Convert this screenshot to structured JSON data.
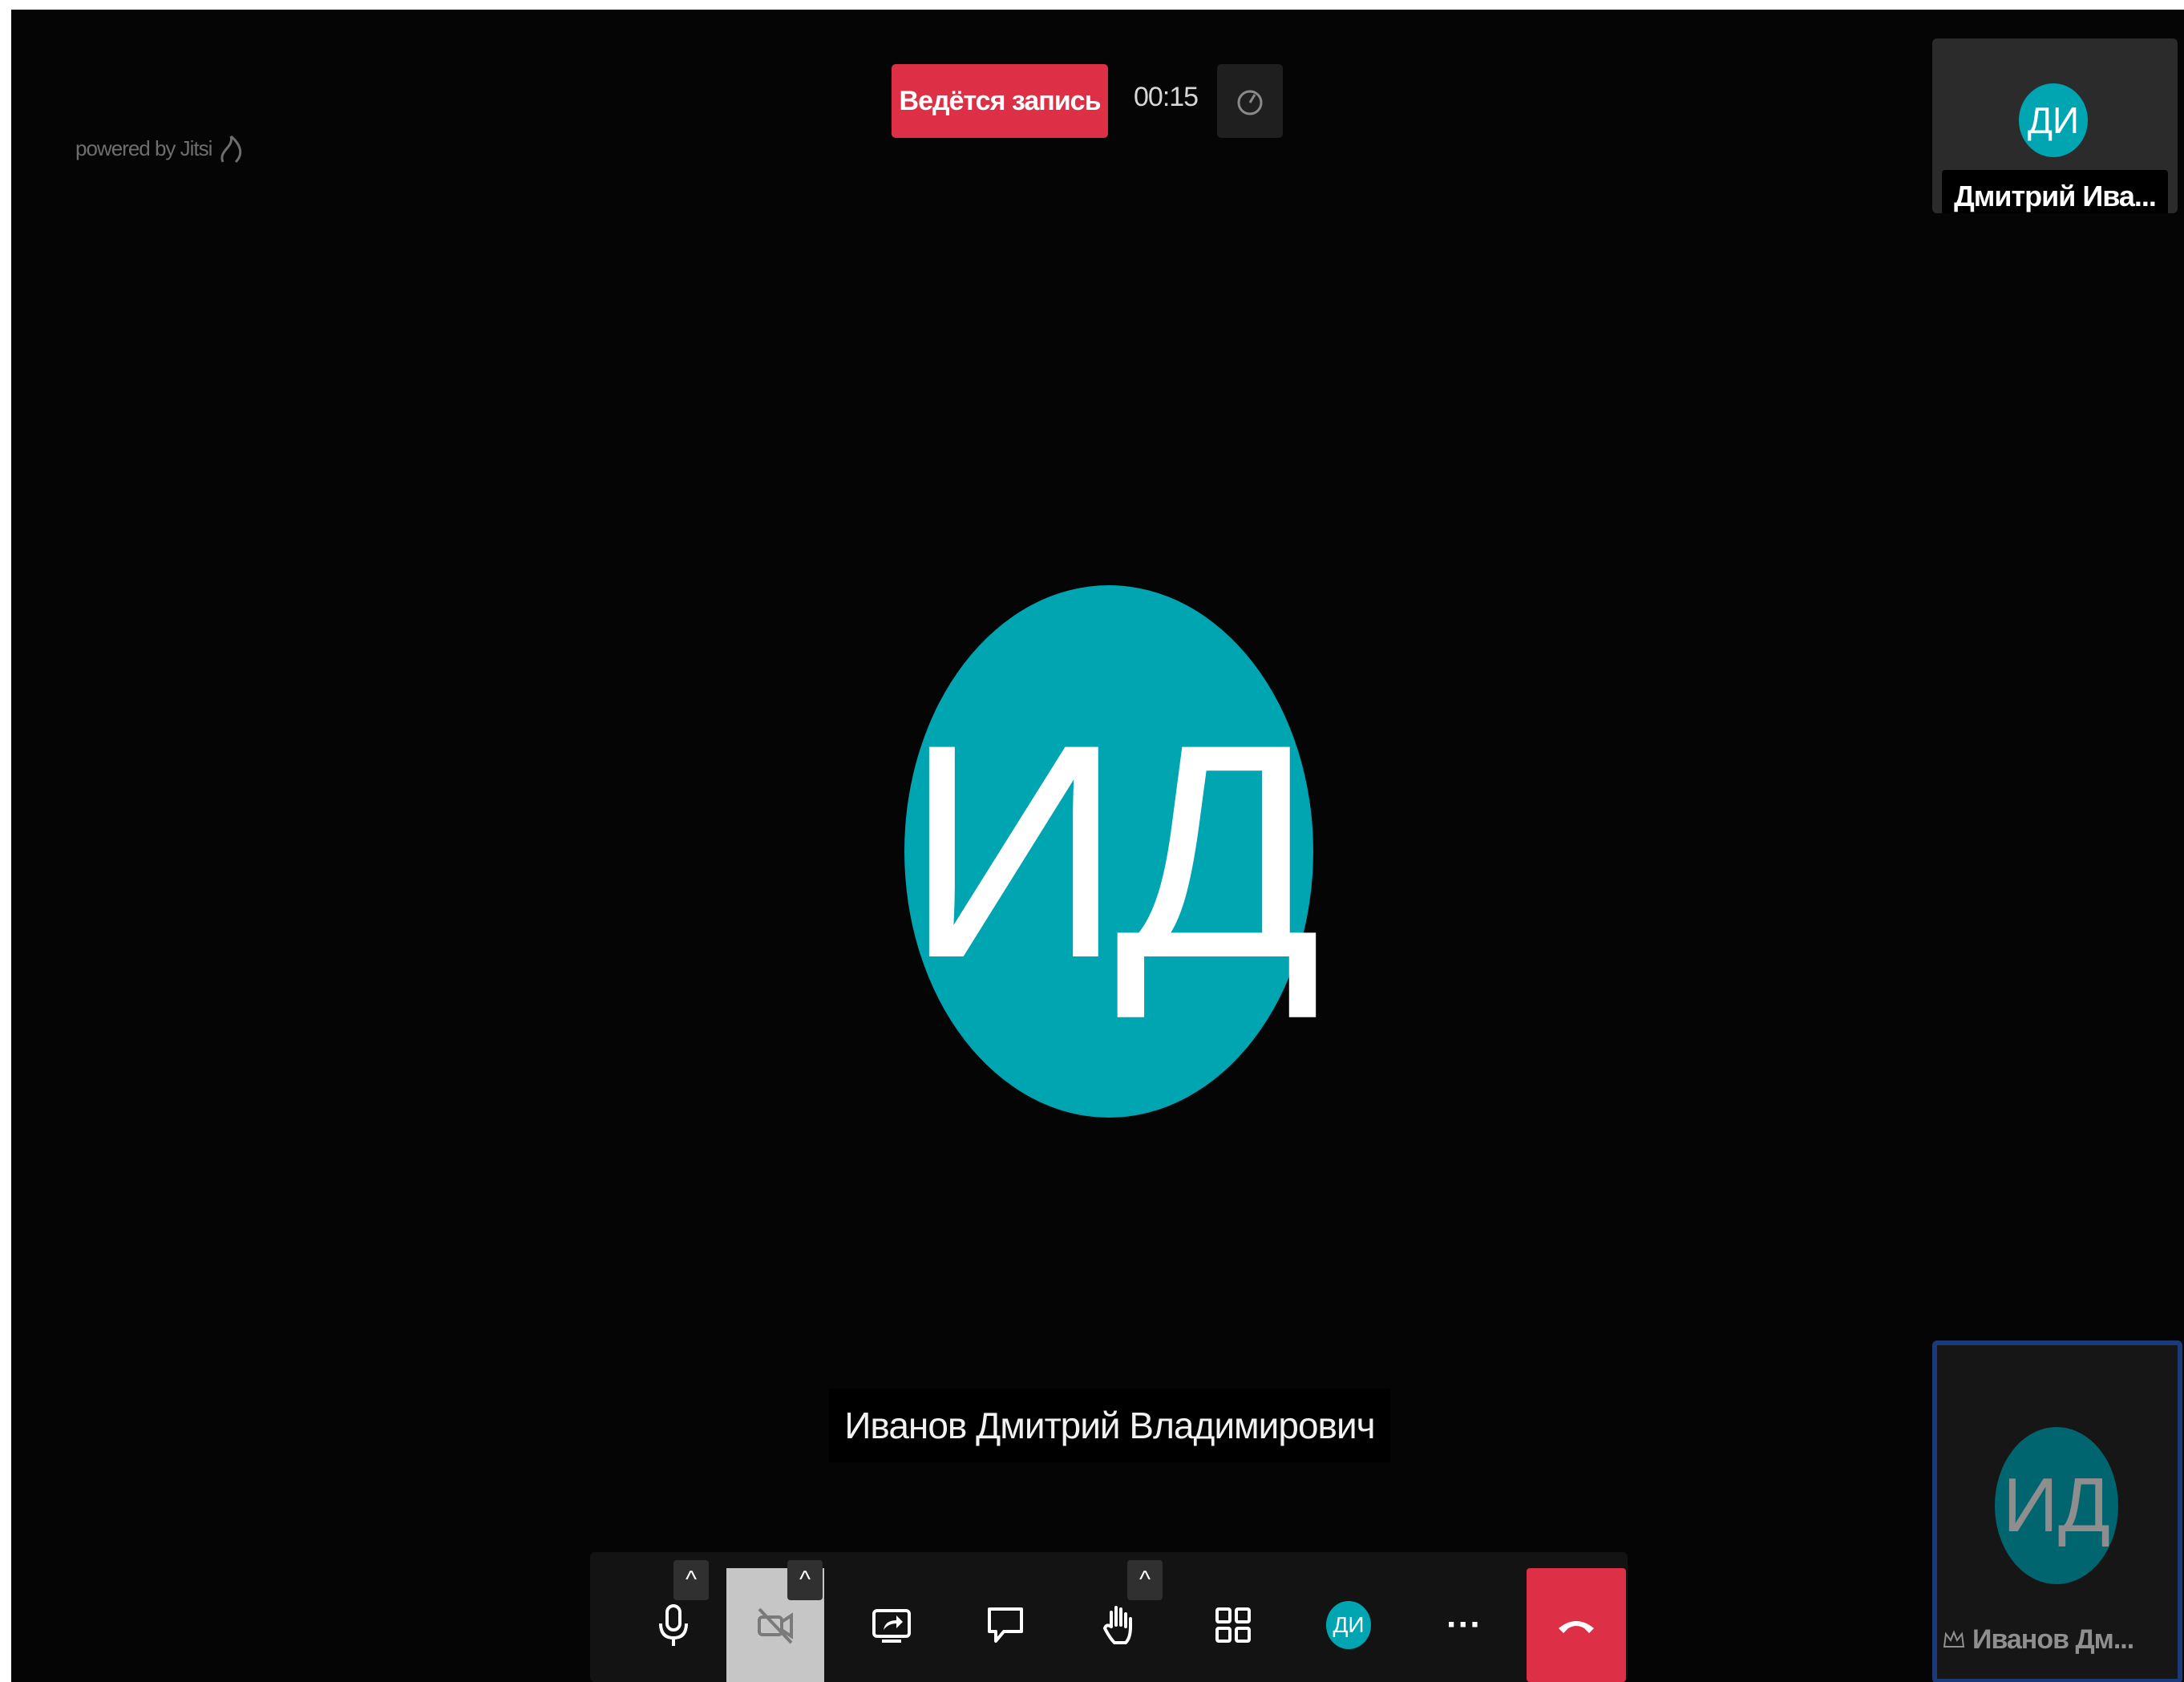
{
  "branding": {
    "watermark": "powered by Jitsi"
  },
  "recording": {
    "label": "Ведётся запись",
    "timer": "00:15"
  },
  "main": {
    "avatar_initials": "ИД",
    "speaker_name": "Иванов Дмитрий Владимирович"
  },
  "thumbnails": [
    {
      "initials": "ДИ",
      "name": "Дмитрий Ива..."
    },
    {
      "initials": "ИД",
      "name": "Иванов Дм..."
    }
  ],
  "toolbar": {
    "buttons": [
      "microphone-icon",
      "camera-off-icon",
      "screen-share-icon",
      "chat-icon",
      "raise-hand-icon",
      "tile-view-icon",
      "profile-avatar",
      "more-icon",
      "hangup-icon"
    ],
    "profile_initials": "ДИ",
    "caret": "^",
    "more_label": "···"
  },
  "colors": {
    "accent": "#00a5b2",
    "record_red": "#dd2f45",
    "hangup_red": "#dd2f45",
    "background": "#050505"
  }
}
